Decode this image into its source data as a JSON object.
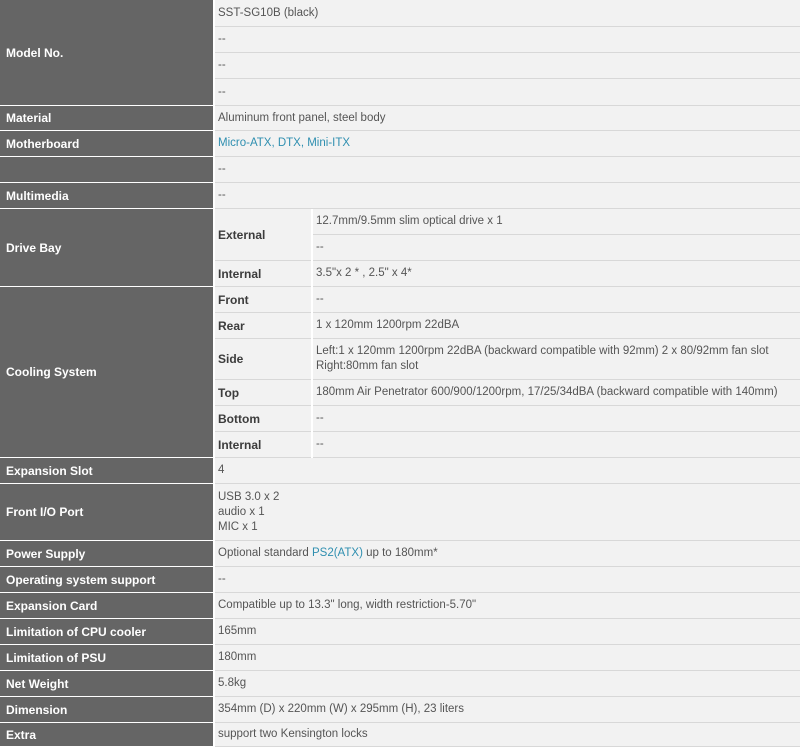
{
  "model": {
    "label": "Model No.",
    "values": [
      "SST-SG10B (black)",
      "--",
      "--",
      "--"
    ]
  },
  "material": {
    "label": "Material",
    "value": "Aluminum front panel, steel body"
  },
  "motherboard": {
    "label": "Motherboard",
    "link_text": "Micro-ATX, DTX, Mini-ITX",
    "extra": "--"
  },
  "multimedia": {
    "label": "Multimedia",
    "value": "--"
  },
  "drive_bay": {
    "label": "Drive Bay",
    "external": {
      "label": "External",
      "values": [
        "12.7mm/9.5mm slim optical drive x 1",
        "--"
      ]
    },
    "internal": {
      "label": "Internal",
      "value": "3.5\"x 2 * , 2.5\" x 4*"
    }
  },
  "cooling": {
    "label": "Cooling System",
    "front": {
      "label": "Front",
      "value": "--"
    },
    "rear": {
      "label": "Rear",
      "value": "1 x 120mm 1200rpm 22dBA"
    },
    "side": {
      "label": "Side",
      "line1": "Left:1 x 120mm 1200rpm 22dBA (backward compatible with 92mm) 2 x 80/92mm fan slot",
      "line2": "Right:80mm fan slot"
    },
    "top": {
      "label": "Top",
      "value": "180mm Air Penetrator 600/900/1200rpm, 17/25/34dBA (backward compatible with 140mm)"
    },
    "bottom": {
      "label": "Bottom",
      "value": "--"
    },
    "internal": {
      "label": "Internal",
      "value": "--"
    }
  },
  "expansion_slot": {
    "label": "Expansion Slot",
    "value": "4"
  },
  "front_io": {
    "label": "Front I/O Port",
    "lines": [
      "USB 3.0 x 2",
      "audio x 1",
      "MIC x 1"
    ]
  },
  "power_supply": {
    "label": "Power Supply",
    "prefix": "Optional standard ",
    "link_text": "PS2(ATX)",
    "suffix": " up to 180mm*"
  },
  "os_support": {
    "label": "Operating system support",
    "value": "--"
  },
  "expansion_card": {
    "label": "Expansion Card",
    "value": "Compatible up to 13.3\" long, width restriction-5.70\""
  },
  "cpu_cooler": {
    "label": "Limitation of CPU cooler",
    "value": "165mm"
  },
  "psu_limit": {
    "label": "Limitation of PSU",
    "value": "180mm"
  },
  "net_weight": {
    "label": "Net Weight",
    "value": "5.8kg"
  },
  "dimension": {
    "label": "Dimension",
    "value": "354mm (D) x 220mm (W) x 295mm (H), 23 liters"
  },
  "extra": {
    "label": "Extra",
    "value": "support two Kensington locks"
  }
}
